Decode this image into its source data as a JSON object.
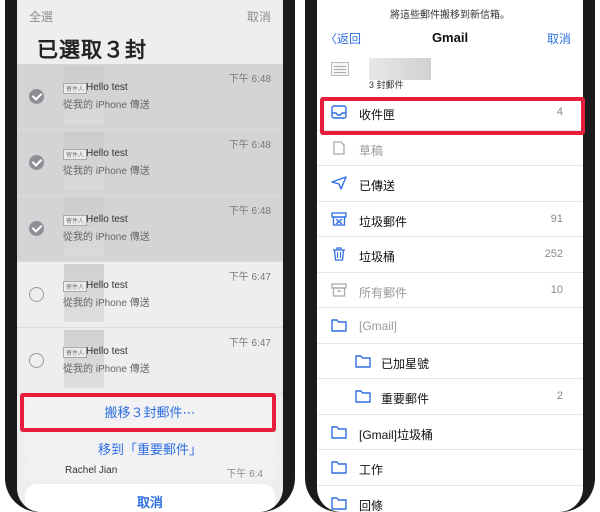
{
  "left": {
    "select_all": "全選",
    "cancel": "取消",
    "title": "已選取３封",
    "mails": [
      {
        "tag": "寄件人",
        "subject": "Hello test",
        "preview": "從我的 iPhone 傳送",
        "time": "下午 6:48",
        "selected": true
      },
      {
        "tag": "寄件人",
        "subject": "Hello test",
        "preview": "從我的 iPhone 傳送",
        "time": "下午 6:48",
        "selected": true
      },
      {
        "tag": "寄件人",
        "subject": "Hello test",
        "preview": "從我的 iPhone 傳送",
        "time": "下午 6:48",
        "selected": true
      },
      {
        "tag": "寄件人",
        "subject": "Hello test",
        "preview": "從我的 iPhone 傳送",
        "time": "下午 6:47",
        "selected": false
      },
      {
        "tag": "寄件人",
        "subject": "Hello test",
        "preview": "從我的 iPhone 傳送",
        "time": "下午 6:47",
        "selected": false
      }
    ],
    "action_sheet": {
      "move_label": "搬移３封郵件⋯",
      "move_to_important": "移到「重要郵件」",
      "peek_sender": "Rachel Jian",
      "peek_time": "下午 6:4",
      "cancel": "取消"
    }
  },
  "right": {
    "hint": "將這些郵件搬移到新信箱。",
    "back": "返回",
    "title": "Gmail",
    "cancel": "取消",
    "mail_count": "3 封郵件",
    "folders": [
      {
        "icon": "inbox-icon",
        "name": "收件匣",
        "count": "4"
      },
      {
        "icon": "draft-icon",
        "name": "草稿",
        "count": ""
      },
      {
        "icon": "sent-icon",
        "name": "已傳送",
        "count": ""
      },
      {
        "icon": "junk-icon",
        "name": "垃圾郵件",
        "count": "91"
      },
      {
        "icon": "trash-icon",
        "name": "垃圾桶",
        "count": "252"
      },
      {
        "icon": "archive-icon",
        "name": "所有郵件",
        "count": "10"
      },
      {
        "icon": "folder-icon",
        "name": "[Gmail]",
        "count": ""
      },
      {
        "icon": "folder-icon",
        "name": "已加星號",
        "count": ""
      },
      {
        "icon": "folder-icon",
        "name": "重要郵件",
        "count": "2"
      },
      {
        "icon": "folder-icon",
        "name": "[Gmail]垃圾桶",
        "count": ""
      },
      {
        "icon": "folder-icon",
        "name": "工作",
        "count": ""
      },
      {
        "icon": "folder-icon",
        "name": "回條",
        "count": ""
      }
    ]
  },
  "colors": {
    "accent": "#2f6fe0",
    "highlight": "#e61e3c"
  }
}
